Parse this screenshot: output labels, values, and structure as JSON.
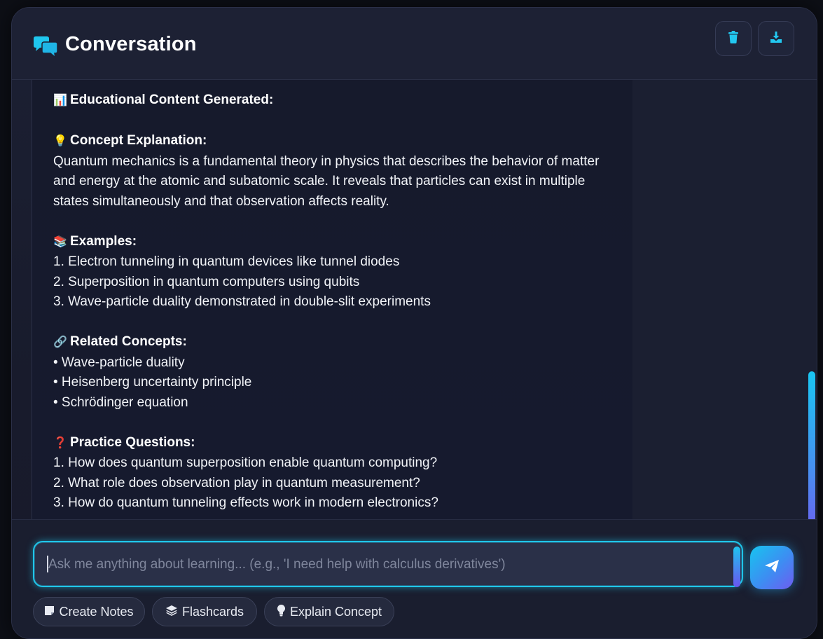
{
  "header": {
    "title": "Conversation",
    "icon": "chat-bubbles-icon",
    "actions": [
      {
        "name": "clear-chat-button",
        "icon": "trash-icon"
      },
      {
        "name": "export-chat-button",
        "icon": "download-icon"
      }
    ]
  },
  "message": {
    "heading": "Educational Content Generated:",
    "heading_emoji": "📊",
    "concept": {
      "emoji": "💡",
      "title": "Concept Explanation:",
      "text": "Quantum mechanics is a fundamental theory in physics that describes the behavior of matter and energy at the atomic and subatomic scale. It reveals that particles can exist in multiple states simultaneously and that observation affects reality."
    },
    "examples": {
      "emoji": "📚",
      "title": "Examples:",
      "items": [
        "1. Electron tunneling in quantum devices like tunnel diodes",
        "2. Superposition in quantum computers using qubits",
        "3. Wave-particle duality demonstrated in double-slit experiments"
      ]
    },
    "related": {
      "emoji": "🔗",
      "title": "Related Concepts:",
      "items": [
        "• Wave-particle duality",
        "• Heisenberg uncertainty principle",
        "• Schrödinger equation"
      ]
    },
    "practice": {
      "emoji": "❓",
      "title": "Practice Questions:",
      "items": [
        "1. How does quantum superposition enable quantum computing?",
        "2. What role does observation play in quantum measurement?",
        "3. How do quantum tunneling effects work in modern electronics?"
      ]
    }
  },
  "input": {
    "placeholder": "Ask me anything about learning... (e.g., 'I need help with calculus derivatives')",
    "send_icon": "paper-plane-icon"
  },
  "quick_actions": [
    {
      "label": "Create Notes",
      "icon": "note-icon"
    },
    {
      "label": "Flashcards",
      "icon": "layers-icon"
    },
    {
      "label": "Explain Concept",
      "icon": "lightbulb-icon"
    }
  ],
  "colors": {
    "accent": "#20c6ea",
    "accent2": "#6e5cf0",
    "panel": "#1c2033",
    "text": "#f2f4f8"
  }
}
